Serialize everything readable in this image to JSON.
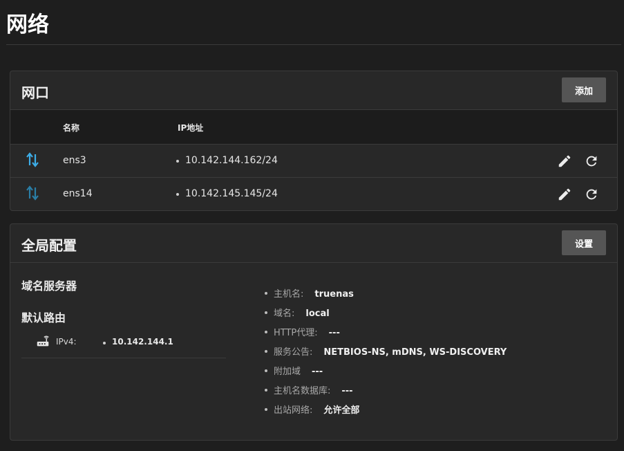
{
  "page": {
    "title": "网络"
  },
  "interfaces": {
    "title": "网口",
    "add_label": "添加",
    "columns": {
      "name": "名称",
      "ip": "IP地址"
    },
    "rows": [
      {
        "name": "ens3",
        "ip": "10.142.144.162/24",
        "status_icon": "link-up-icon",
        "status_color": "#3daee9"
      },
      {
        "name": "ens14",
        "ip": "10.142.145.145/24",
        "status_icon": "link-down-icon",
        "status_color": "#2a7fa8"
      }
    ]
  },
  "global": {
    "title": "全局配置",
    "settings_label": "设置",
    "nameservers_title": "域名服务器",
    "default_route_title": "默认路由",
    "route": {
      "label": "IPv4:",
      "value": "10.142.144.1"
    },
    "items": [
      {
        "key": "主机名:",
        "value": "truenas"
      },
      {
        "key": "域名:",
        "value": "local"
      },
      {
        "key": "HTTP代理:",
        "value": "---"
      },
      {
        "key": "服务公告:",
        "value": "NETBIOS-NS, mDNS, WS-DISCOVERY"
      },
      {
        "key": "附加域",
        "value": "---"
      },
      {
        "key": "主机名数据库:",
        "value": "---"
      },
      {
        "key": "出站网络:",
        "value": "允许全部"
      }
    ]
  },
  "colors": {
    "background": "#1e1e1e",
    "card": "#282828",
    "button": "#555555",
    "accent": "#3daee9"
  }
}
